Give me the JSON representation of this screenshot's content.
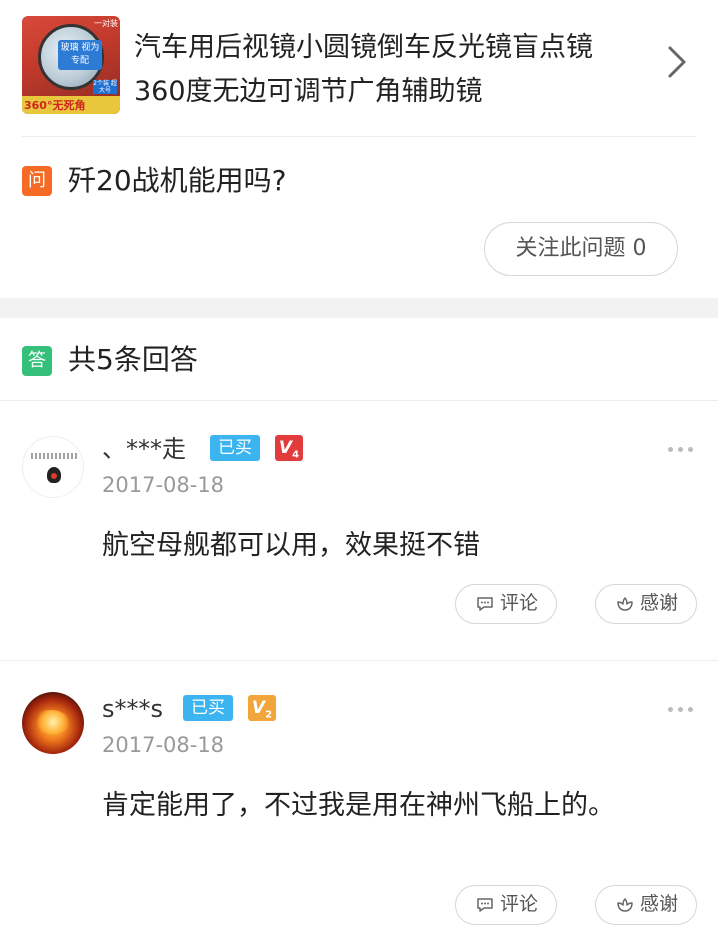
{
  "product": {
    "title": "汽车用后视镜小圆镜倒车反光镜盲点镜360度无边可调节广角辅助镜",
    "thumb_caption": "360°无死角",
    "thumb_tag": "玻璃 视为专配",
    "thumb_corner": "一对装",
    "thumb_small": "2个装 超大号"
  },
  "question": {
    "badge": "问",
    "text": "歼20战机能用吗?",
    "follow_button": "关注此问题 0"
  },
  "answers_header": {
    "badge": "答",
    "count_label": "共5条回答"
  },
  "answers": [
    {
      "user": "、***走",
      "bought_badge": "已买",
      "vip_level": "V",
      "vip_num": "4",
      "date": "2017-08-18",
      "text": "航空母舰都可以用，效果挺不错",
      "comment_label": "评论",
      "thanks_label": "感谢"
    },
    {
      "user": "s***s",
      "bought_badge": "已买",
      "vip_level": "V",
      "vip_num": "2",
      "date": "2017-08-18",
      "text": "肯定能用了，不过我是用在神州飞船上的。",
      "comment_label": "评论",
      "thanks_label": "感谢"
    }
  ],
  "colors": {
    "question_badge": "#f56a24",
    "answer_badge": "#35c07a",
    "bought_badge": "#3bb4f0",
    "vip4": "#e23b3b",
    "vip2": "#f2a53a"
  },
  "icons": [
    "chevron-right-icon",
    "more-dots-icon",
    "comment-icon",
    "thanks-flower-icon"
  ]
}
